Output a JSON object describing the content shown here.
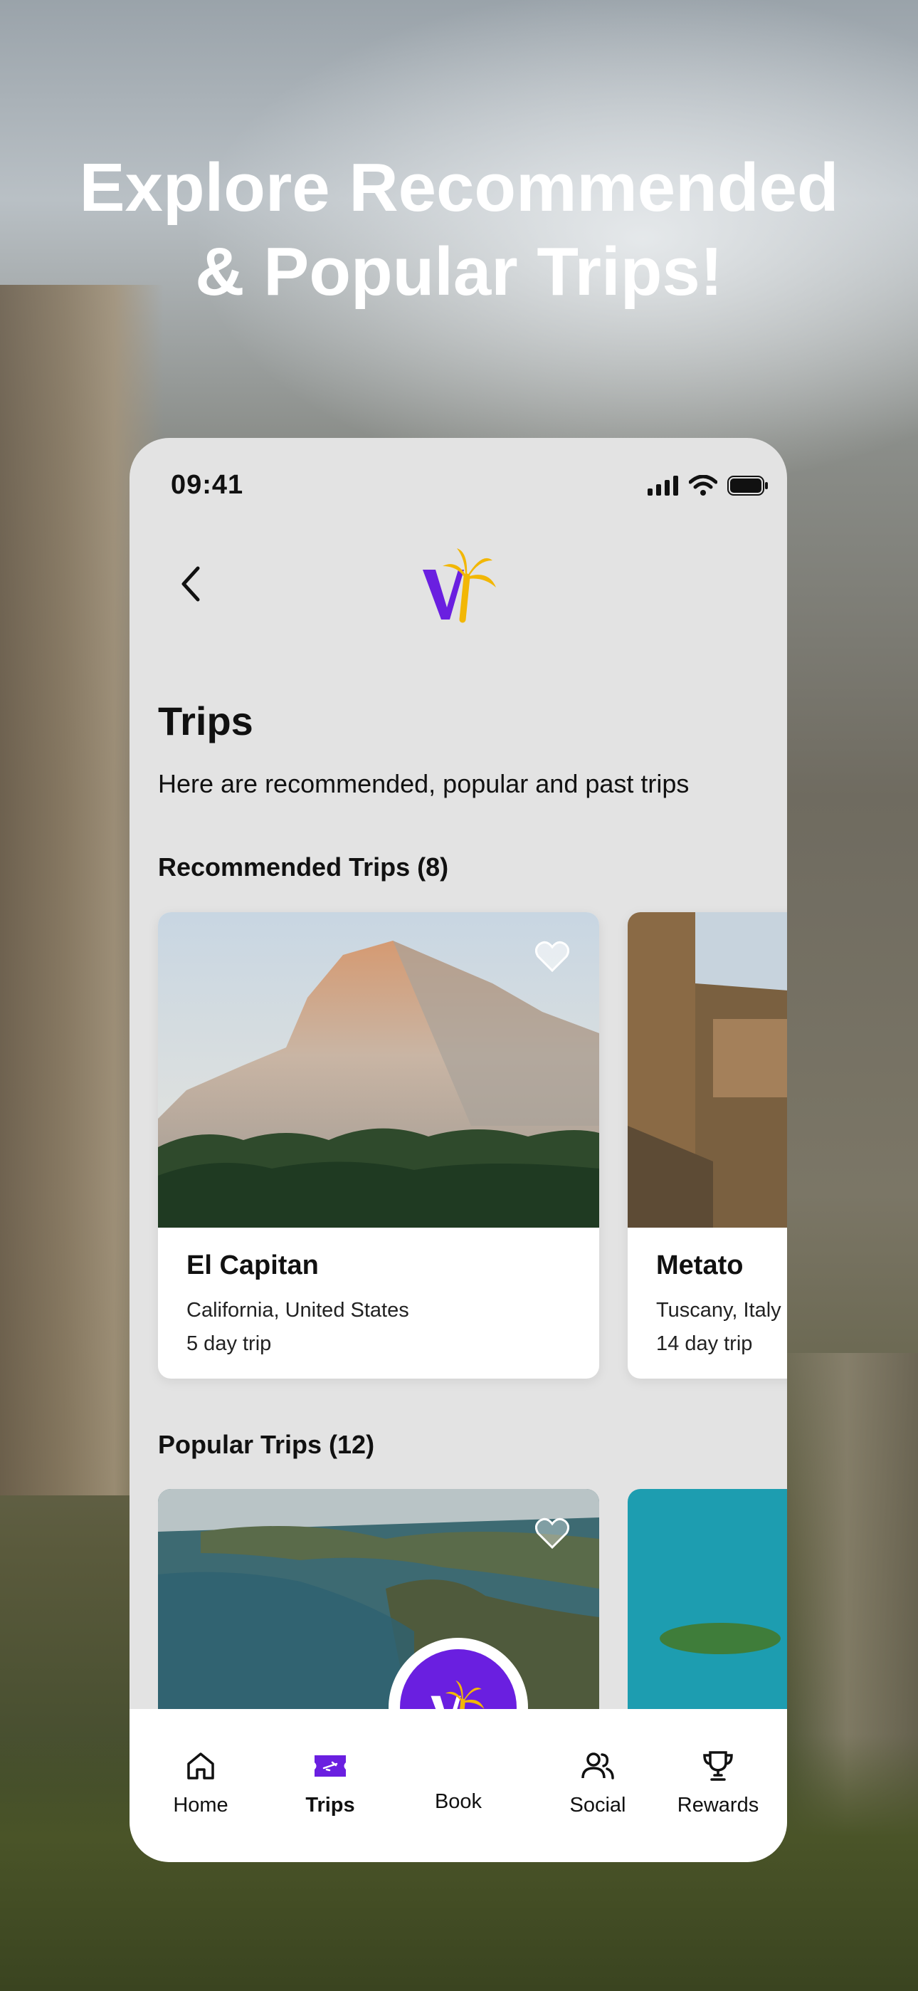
{
  "headline": {
    "line1": "Explore Recommended",
    "line2": "& Popular Trips!"
  },
  "status": {
    "time": "09:41"
  },
  "page": {
    "title": "Trips",
    "subtitle": "Here are recommended, popular and past trips"
  },
  "recommended": {
    "title": "Recommended Trips (8)",
    "cards": [
      {
        "name": "El Capitan",
        "location": "California, United States",
        "duration": "5 day trip"
      },
      {
        "name": "Metato",
        "location": "Tuscany, Italy",
        "duration": "14 day trip"
      }
    ]
  },
  "popular": {
    "title": "Popular Trips (12)"
  },
  "nav": {
    "items": [
      {
        "label": "Home"
      },
      {
        "label": "Trips"
      },
      {
        "label": "Book"
      },
      {
        "label": "Social"
      },
      {
        "label": "Rewards"
      }
    ],
    "active": "Trips"
  },
  "colors": {
    "brand_purple": "#6a1fe0",
    "brand_yellow": "#f2b705",
    "nav_active": "#6a1fe0"
  }
}
